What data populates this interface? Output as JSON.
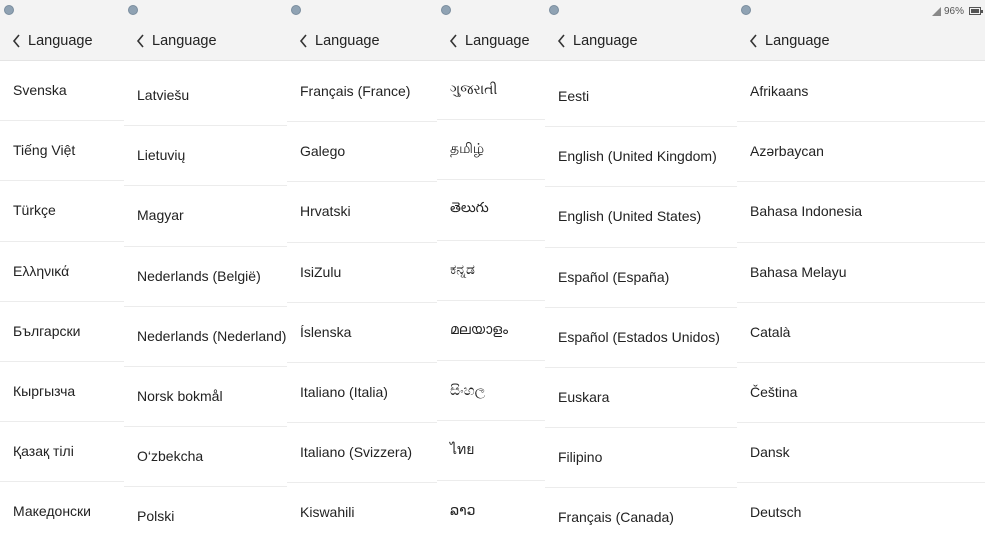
{
  "panels": [
    {
      "header": {
        "title": "Language"
      },
      "items": [
        "Svenska",
        "Tiếng Việt",
        "Türkçe",
        "Ελληνικά",
        "Български",
        "Кыргызча",
        "Қазақ тілі",
        "Македонски"
      ]
    },
    {
      "header": {
        "title": "Language"
      },
      "items": [
        "Latviešu",
        "Lietuvių",
        "Magyar",
        "Nederlands (België)",
        "Nederlands (Nederland)",
        "Norsk bokmål",
        "O‘zbekcha",
        "Polski"
      ]
    },
    {
      "header": {
        "title": "Language"
      },
      "items": [
        "Français (France)",
        "Galego",
        "Hrvatski",
        "IsiZulu",
        "Íslenska",
        "Italiano (Italia)",
        "Italiano (Svizzera)",
        "Kiswahili"
      ]
    },
    {
      "header": {
        "title": "Language"
      },
      "items": [
        "ગુજરાતી",
        "தமிழ்",
        "తెలుగు",
        "ಕನ್ನಡ",
        "മലയാളം",
        "සිංහල",
        "ไทย",
        "ລາວ"
      ]
    },
    {
      "header": {
        "title": "Language"
      },
      "items": [
        "Eesti",
        "English (United Kingdom)",
        "English (United States)",
        "Español (España)",
        "Español (Estados Unidos)",
        "Euskara",
        "Filipino",
        "Français (Canada)"
      ]
    },
    {
      "header": {
        "title": "Language"
      },
      "status": {
        "battery": "96%"
      },
      "items": [
        "Afrikaans",
        "Azərbaycan",
        "Bahasa Indonesia",
        "Bahasa Melayu",
        "Català",
        "Čeština",
        "Dansk",
        "Deutsch"
      ]
    }
  ]
}
